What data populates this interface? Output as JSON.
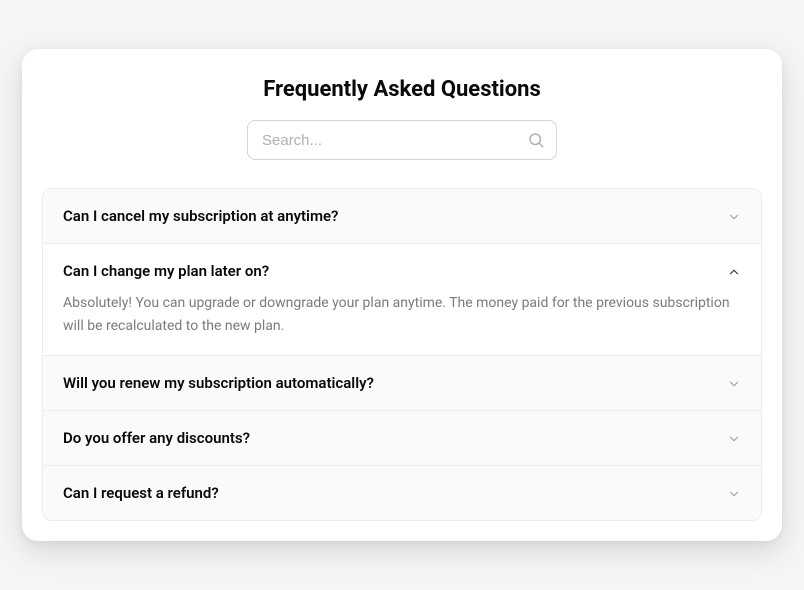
{
  "title": "Frequently Asked Questions",
  "search": {
    "placeholder": "Search..."
  },
  "faq": {
    "items": [
      {
        "question": "Can I cancel my subscription at anytime?",
        "answer": "",
        "expanded": false
      },
      {
        "question": "Can I change my plan later on?",
        "answer": "Absolutely! You can upgrade or downgrade your plan anytime. The money paid for the previous subscription will be recalculated to the new plan.",
        "expanded": true
      },
      {
        "question": "Will you renew my subscription automatically?",
        "answer": "",
        "expanded": false
      },
      {
        "question": "Do you offer any discounts?",
        "answer": "",
        "expanded": false
      },
      {
        "question": "Can I request a refund?",
        "answer": "",
        "expanded": false
      }
    ]
  }
}
